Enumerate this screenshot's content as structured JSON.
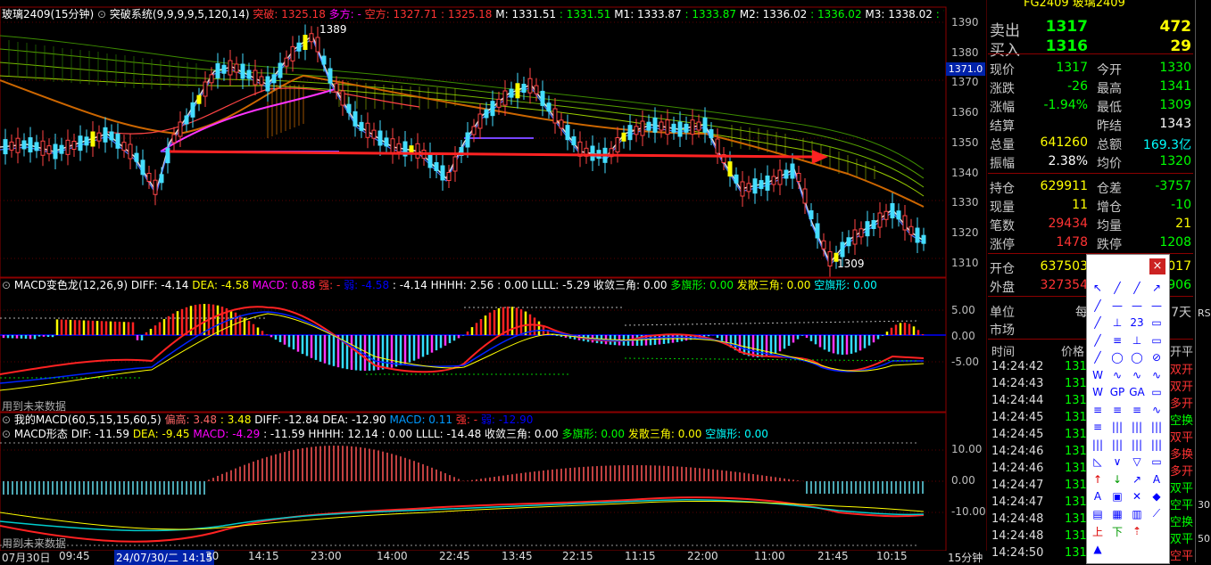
{
  "main_title": {
    "symbol": "玻璃2409(15分钟)",
    "indicator": "突破系统(9,9,9,9,5,120,14)",
    "items": [
      {
        "label": "突破: 1325.18",
        "color": "#ff3333"
      },
      {
        "label": "多方: -",
        "color": "#ff00ff"
      },
      {
        "label": "空方: 1327.71",
        "color": "#ff3333"
      },
      {
        "label": ": 1325.18",
        "color": "#ff3333"
      },
      {
        "label": "M: 1331.51",
        "color": "#ffffff"
      },
      {
        "label": ": 1331.51",
        "color": "#00ff00"
      },
      {
        "label": "M1: 1333.87",
        "color": "#ffffff"
      },
      {
        "label": ": 1333.87",
        "color": "#00ff00"
      },
      {
        "label": "M2: 1336.02",
        "color": "#ffffff"
      },
      {
        "label": ": 1336.02",
        "color": "#00ff00"
      },
      {
        "label": "M3: 1338.02",
        "color": "#ffffff"
      },
      {
        "label": ": 1338.0",
        "color": "#00ff00"
      }
    ],
    "high_label": "1389",
    "low_label": "1309",
    "price_tag": "1371.0",
    "price_axis": [
      "1390",
      "1380",
      "1370",
      "1360",
      "1350",
      "1340",
      "1330",
      "1320",
      "1310"
    ]
  },
  "macd1": {
    "title": "MACD变色龙(12,26,9)",
    "items": [
      {
        "label": "DIFF: -4.14",
        "color": "#ffffff"
      },
      {
        "label": "DEA: -4.58",
        "color": "#ffff00"
      },
      {
        "label": "MACD: 0.88",
        "color": "#ff00ff"
      },
      {
        "label": "强: -",
        "color": "#ff3333"
      },
      {
        "label": "弱: -4.58",
        "color": "#0000ff"
      },
      {
        "label": ": -4.14",
        "color": "#ffffff"
      },
      {
        "label": "HHHH: 2.56",
        "color": "#ffffff"
      },
      {
        "label": ": 0.00",
        "color": "#ffffff"
      },
      {
        "label": "LLLL: -5.29",
        "color": "#ffffff"
      },
      {
        "label": "收敛三角: 0.00",
        "color": "#ffffff"
      },
      {
        "label": "多旗形: 0.00",
        "color": "#00ff00"
      },
      {
        "label": "发散三角: 0.00",
        "color": "#ffff00"
      },
      {
        "label": "空旗形: 0.00",
        "color": "#00ffff"
      }
    ],
    "axis": [
      "5.00",
      "0.00",
      "-5.00"
    ],
    "footer": "用到未来数据"
  },
  "macd2": {
    "title1": "我的MACD(60,5,15,15,60,5)",
    "items1": [
      {
        "label": "偏高: 3.48",
        "color": "#ff6666"
      },
      {
        "label": ": 3.48",
        "color": "#ffff00"
      },
      {
        "label": "DIFF: -12.84",
        "color": "#ffffff"
      },
      {
        "label": "DEA: -12.90",
        "color": "#ffffff"
      },
      {
        "label": "MACD: 0.11",
        "color": "#0099ff"
      },
      {
        "label": "强: -",
        "color": "#ff3333"
      },
      {
        "label": "弱: -12.90",
        "color": "#0000ff"
      }
    ],
    "title2": "MACD形态",
    "items2": [
      {
        "label": "DIF: -11.59",
        "color": "#ffffff"
      },
      {
        "label": "DEA: -9.45",
        "color": "#ffff00"
      },
      {
        "label": "MACD: -4.29",
        "color": "#ff00ff"
      },
      {
        "label": ": -11.59",
        "color": "#ffffff"
      },
      {
        "label": "HHHH: 12.14",
        "color": "#ffffff"
      },
      {
        "label": ": 0.00",
        "color": "#ffffff"
      },
      {
        "label": "LLLL: -14.48",
        "color": "#ffffff"
      },
      {
        "label": "收敛三角: 0.00",
        "color": "#ffffff"
      },
      {
        "label": "多旗形: 0.00",
        "color": "#00ff00"
      },
      {
        "label": "发散三角: 0.00",
        "color": "#ffff00"
      },
      {
        "label": "空旗形: 0.00",
        "color": "#00ffff"
      }
    ],
    "axis": [
      "10.00",
      "0.00",
      "-10.00"
    ],
    "footer": "用到未来数据"
  },
  "time_axis": {
    "labels": [
      "07月30日",
      "09:45",
      "24/07/30/二 14:15",
      "30",
      "14:15",
      "23:00",
      "14:00",
      "22:45",
      "13:45",
      "22:15",
      "11:15",
      "22:00",
      "11:00",
      "21:45",
      "10:15"
    ],
    "period": "15分钟"
  },
  "quote": {
    "top_symbol": "FG2409 玻璃2409",
    "rows": [
      {
        "l1": "卖出",
        "v1": "1317",
        "v1c": "#00ff00",
        "l2": "",
        "v2": "472",
        "v2c": "#ffff00",
        "big": true
      },
      {
        "l1": "买入",
        "v1": "1316",
        "v1c": "#00ff00",
        "l2": "",
        "v2": "29",
        "v2c": "#ffff00",
        "big": true
      },
      {
        "l1": "现价",
        "v1": "1317",
        "v1c": "#00ff00",
        "l2": "今开",
        "v2": "1330",
        "v2c": "#00ff00"
      },
      {
        "l1": "涨跌",
        "v1": "-26",
        "v1c": "#00ff00",
        "l2": "最高",
        "v2": "1341",
        "v2c": "#00ff00"
      },
      {
        "l1": "涨幅",
        "v1": "-1.94%",
        "v1c": "#00ff00",
        "l2": "最低",
        "v2": "1309",
        "v2c": "#00ff00"
      },
      {
        "l1": "结算",
        "v1": "",
        "v1c": "#fff",
        "l2": "昨结",
        "v2": "1343",
        "v2c": "#ffffff"
      },
      {
        "l1": "总量",
        "v1": "641260",
        "v1c": "#ffff00",
        "l2": "总额",
        "v2": "169.3亿",
        "v2c": "#00ffff"
      },
      {
        "l1": "振幅",
        "v1": "2.38%",
        "v1c": "#ffffff",
        "l2": "均价",
        "v2": "1320",
        "v2c": "#00ff00"
      },
      {
        "l1": "持仓",
        "v1": "629911",
        "v1c": "#ffff00",
        "l2": "仓差",
        "v2": "-3757",
        "v2c": "#00ff00"
      },
      {
        "l1": "现量",
        "v1": "11",
        "v1c": "#ffff00",
        "l2": "增仓",
        "v2": "-10",
        "v2c": "#00ff00"
      },
      {
        "l1": "笔数",
        "v1": "29434",
        "v1c": "#ff3333",
        "l2": "均量",
        "v2": "21",
        "v2c": "#ffff00"
      },
      {
        "l1": "涨停",
        "v1": "1478",
        "v1c": "#ff3333",
        "l2": "跌停",
        "v2": "1208",
        "v2c": "#00ff00"
      },
      {
        "l1": "开仓",
        "v1": "637503",
        "v1c": "#ffff00",
        "l2": "",
        "v2": "5017",
        "v2c": "#ffff00"
      },
      {
        "l1": "外盘",
        "v1": "327354",
        "v1c": "#ff3333",
        "l2": "",
        "v2": "3906",
        "v2c": "#00ff00"
      },
      {
        "l1": "单位",
        "v1": "每",
        "v1c": "#c8c8c8",
        "l2": "",
        "v2": "7天",
        "v2c": "#c8c8c8"
      },
      {
        "l1": "市场",
        "v1": "",
        "v1c": "#fff",
        "l2": "",
        "v2": "",
        "v2c": "#fff"
      }
    ],
    "trade_header": {
      "time": "时间",
      "price": "价格",
      "type": "开平"
    },
    "trades": [
      {
        "time": "14:24:42",
        "price": "131",
        "type": "双开",
        "tc": "#ff3333"
      },
      {
        "time": "14:24:43",
        "price": "131",
        "type": "双开",
        "tc": "#ff3333"
      },
      {
        "time": "14:24:44",
        "price": "131",
        "type": "多开",
        "tc": "#ff3333"
      },
      {
        "time": "14:24:45",
        "price": "131",
        "type": "空换",
        "tc": "#00ff00"
      },
      {
        "time": "14:24:45",
        "price": "131",
        "type": "双平",
        "tc": "#ff3333"
      },
      {
        "time": "14:24:46",
        "price": "131",
        "type": "多换",
        "tc": "#ff3333"
      },
      {
        "time": "14:24:46",
        "price": "131",
        "type": "多开",
        "tc": "#ff3333"
      },
      {
        "time": "14:24:47",
        "price": "131",
        "type": "双平",
        "tc": "#00ff00"
      },
      {
        "time": "14:24:47",
        "price": "131",
        "type": "空平",
        "tc": "#00ff00"
      },
      {
        "time": "14:24:48",
        "price": "131",
        "type": "空换",
        "tc": "#00ff00"
      },
      {
        "time": "14:24:48",
        "price": "131",
        "type": "双平",
        "tc": "#00ff00"
      },
      {
        "time": "14:24:50",
        "price": "131",
        "type": "空平",
        "tc": "#ff3333"
      }
    ],
    "edge_labels": [
      "RS",
      "30",
      "50"
    ]
  },
  "draw_toolbar": {
    "close": "×",
    "tools": [
      "↖",
      "╱",
      "╱",
      "↗",
      "╱",
      "—",
      "—",
      "—",
      "╱",
      "⊥",
      "23",
      "▭",
      "╱",
      "≡",
      "⊥",
      "▭",
      "╱",
      "◯",
      "◯",
      "⊘",
      "W",
      "∿",
      "∿",
      "∿",
      "W",
      "GP",
      "GA",
      "▭",
      "≡",
      "≡",
      "≡",
      "∿",
      "≡",
      "|||",
      "|||",
      "|||",
      "|||",
      "|||",
      "|||",
      "|||",
      "◺",
      "∨",
      "▽",
      "▭",
      "↑",
      "↓",
      "↗",
      "A",
      "A",
      "▣",
      "✕",
      "◆",
      "▤",
      "▦",
      "▥",
      "⟋",
      "上",
      "下",
      "⇡",
      "",
      "▲",
      "",
      "",
      ""
    ]
  }
}
